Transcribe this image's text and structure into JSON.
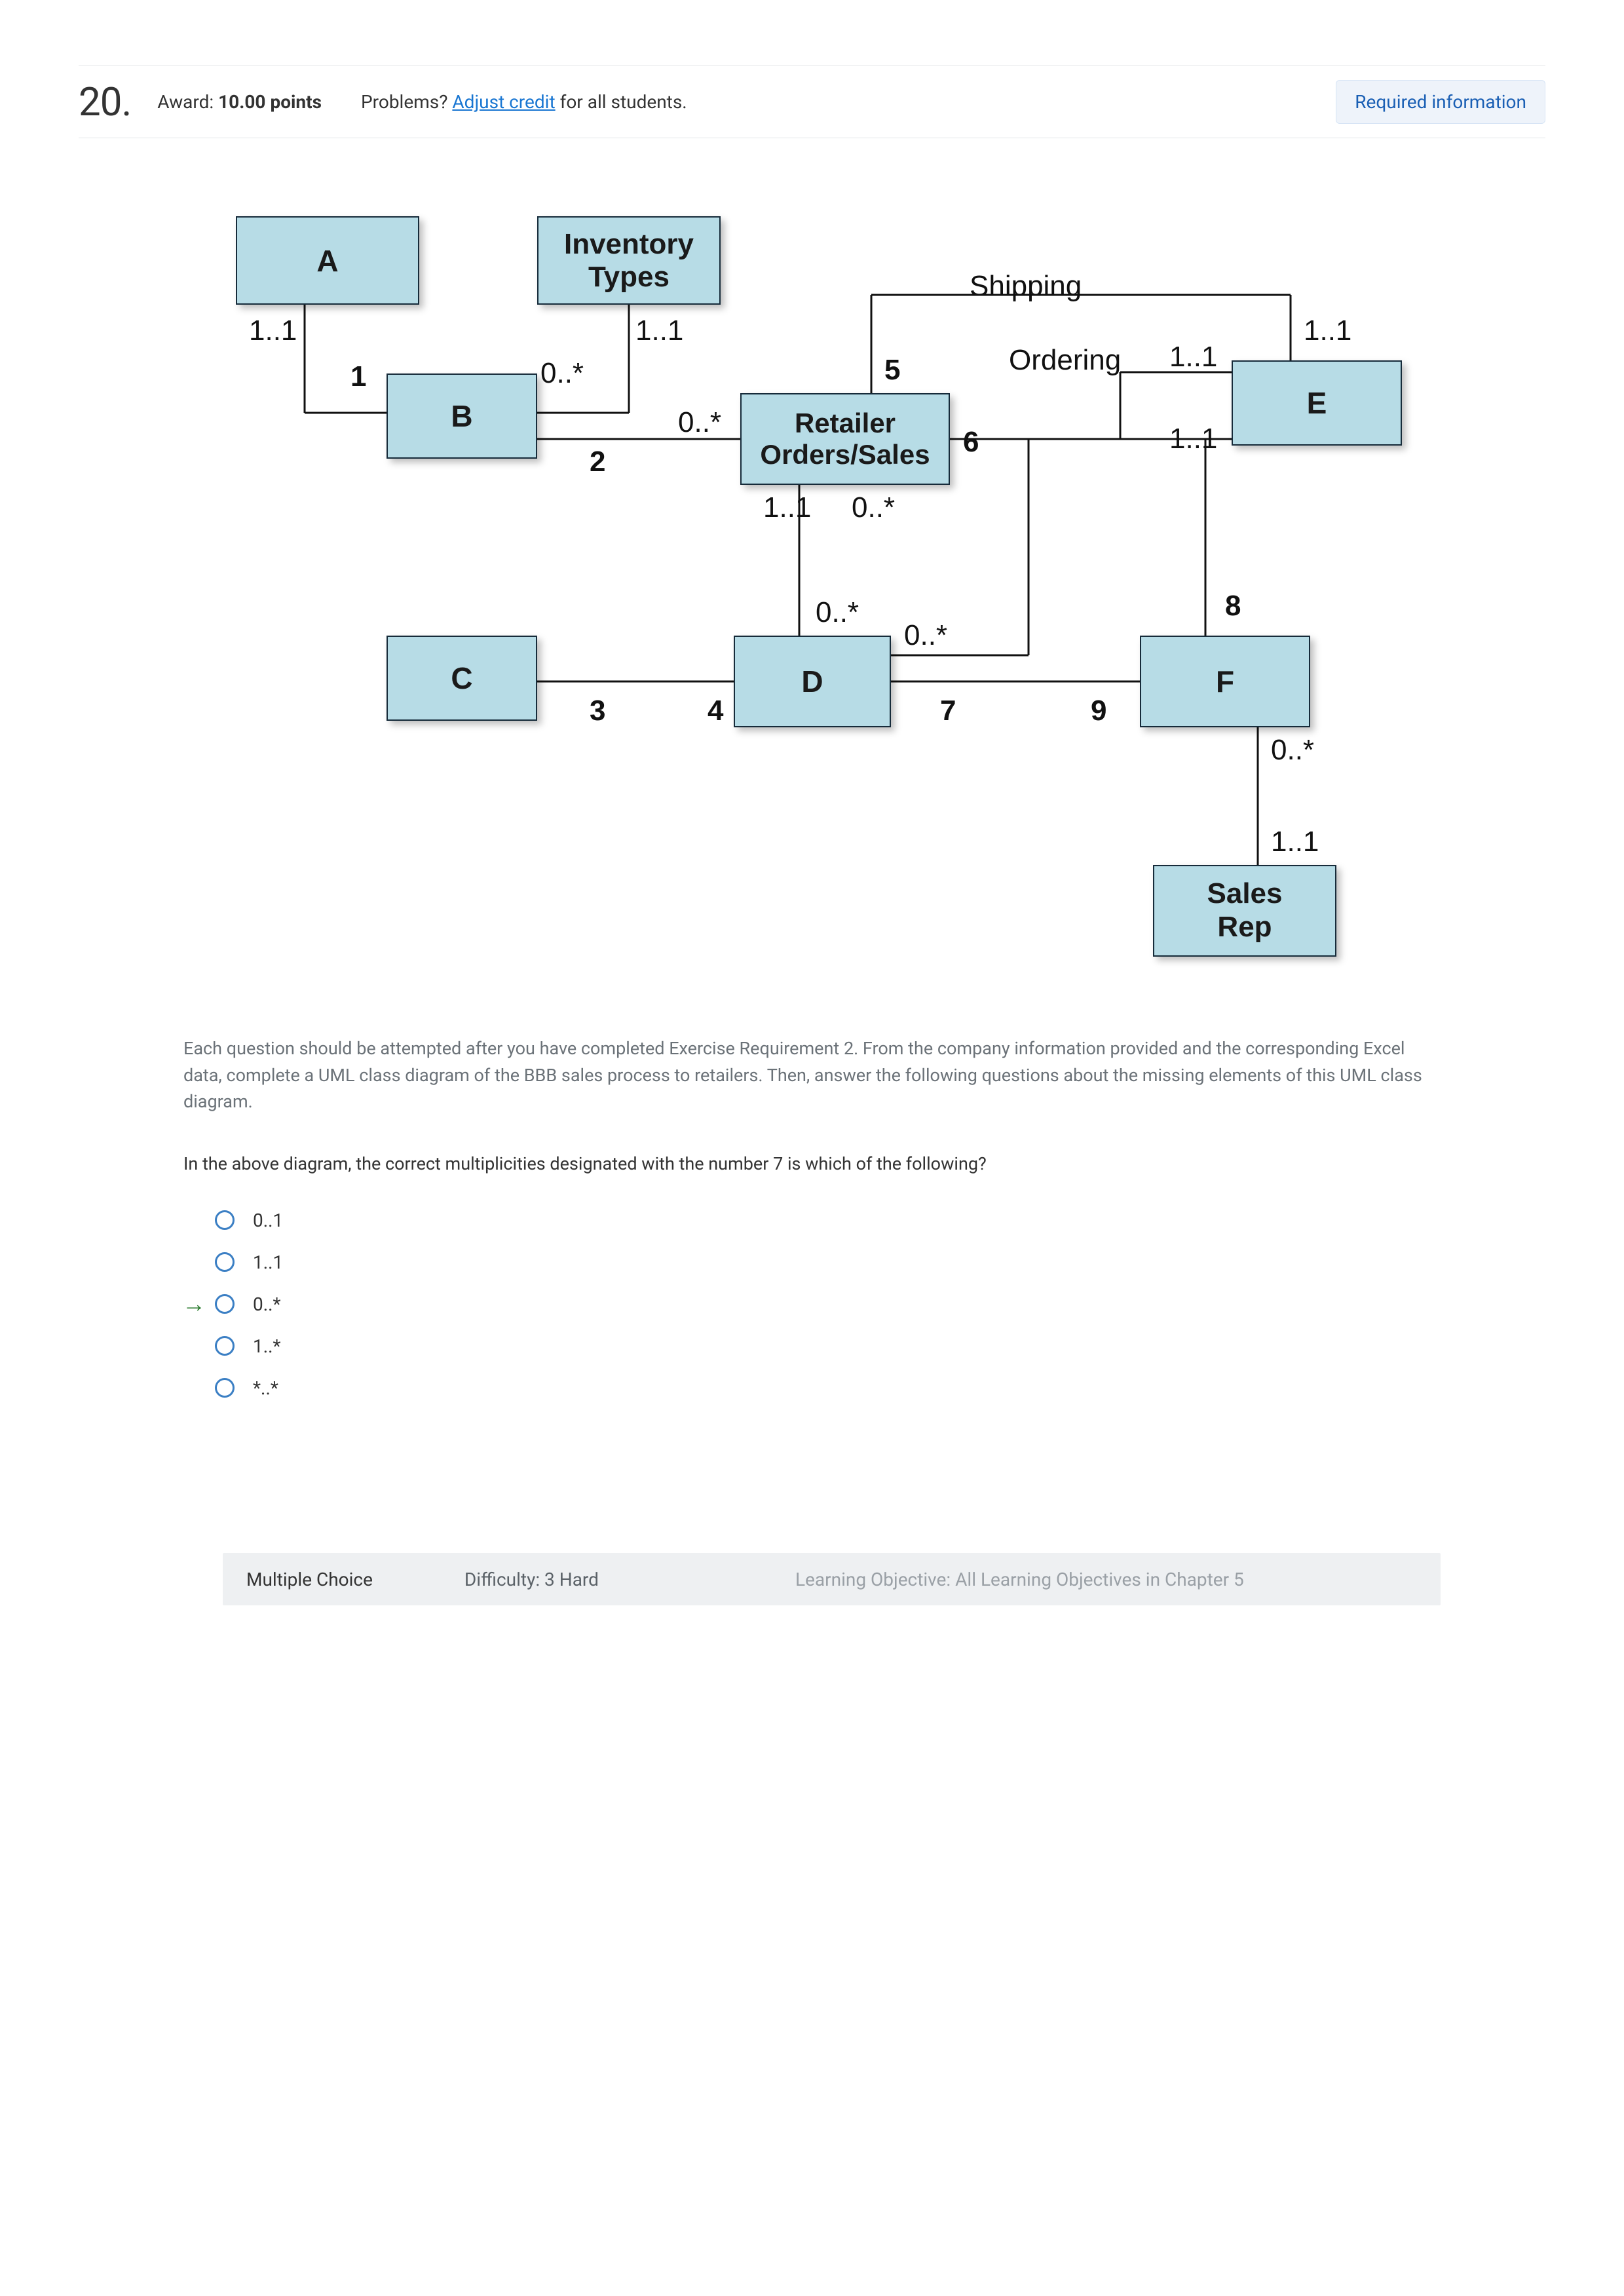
{
  "header": {
    "qnum": "20.",
    "award_prefix": "Award: ",
    "award_value": "10.00 points",
    "problems_prefix": "Problems? ",
    "adjust_credit": "Adjust credit",
    "problems_suffix": " for all students.",
    "required_info": "Required information"
  },
  "diagram": {
    "boxes": {
      "A": "A",
      "B": "B",
      "C": "C",
      "D": "D",
      "E": "E",
      "F": "F",
      "InventoryTypes": "Inventory\nTypes",
      "RetailerOrders": "Retailer Orders/Sales",
      "SalesRep": "Sales\nRep"
    },
    "labels": {
      "m_1_1_a": "1..1",
      "m_1_1_inv": "1..1",
      "m_1_b": "1",
      "m_0s_inv": "0..*",
      "m_2": "2",
      "m_0s_ret": "0..*",
      "m_1_1_ret": "1..1",
      "m_0s_ret_right": "0..*",
      "m_5": "5",
      "m_6": "6",
      "shipping": "Shipping",
      "ordering": "Ordering",
      "m_1_1_e_top": "1..1",
      "m_1_1_e_s": "1..1",
      "m_1_1_e_o": "1..1",
      "m_3": "3",
      "m_4": "4",
      "m_0s_d_top": "0..*",
      "m_0s_d_right": "0..*",
      "m_7": "7",
      "m_8": "8",
      "m_9": "9",
      "m_0s_f": "0..*",
      "m_1_1_sr": "1..1"
    }
  },
  "body": {
    "instructions": "Each question should be attempted after you have completed Exercise Requirement 2. From the company information provided and the corresponding Excel data, complete a UML class diagram of the BBB sales process to retailers. Then, answer the following questions about the missing elements of this UML class diagram.",
    "question": "In the above diagram, the correct multiplicities designated with the number 7 is which of the following?"
  },
  "options": [
    {
      "label": "0..1",
      "correct": false
    },
    {
      "label": "1..1",
      "correct": false
    },
    {
      "label": "0..*",
      "correct": true
    },
    {
      "label": "1..*",
      "correct": false
    },
    {
      "label": "*..*",
      "correct": false
    }
  ],
  "footer": {
    "type": "Multiple Choice",
    "difficulty": "Difficulty: 3 Hard",
    "lo": "Learning Objective: All Learning Objectives in Chapter 5"
  }
}
